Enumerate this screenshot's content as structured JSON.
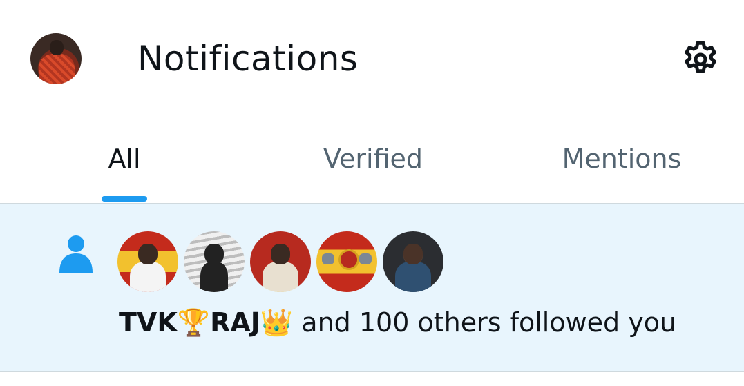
{
  "header": {
    "title": "Notifications",
    "avatar_icon": "user-avatar",
    "settings_icon": "gear-icon"
  },
  "tabs": [
    {
      "label": "All",
      "active": true
    },
    {
      "label": "Verified",
      "active": false
    },
    {
      "label": "Mentions",
      "active": false
    }
  ],
  "notification": {
    "type_icon": "person-icon",
    "actor_name": "TVK🏆RAJ👑",
    "message": " and 100 others followed you",
    "avatars": [
      "avatar-1",
      "avatar-2",
      "avatar-3",
      "avatar-4",
      "avatar-5"
    ]
  },
  "colors": {
    "accent": "#1d9bf0",
    "highlight_bg": "#e8f5fd",
    "text_primary": "#0f1419",
    "text_secondary": "#536471"
  }
}
